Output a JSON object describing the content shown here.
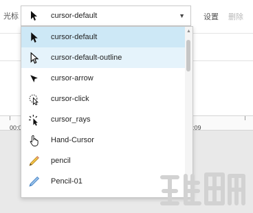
{
  "toolbar": {
    "cursor_label": "光标",
    "selected_value": "cursor-default",
    "settings_label": "设置",
    "delete_label": "删除"
  },
  "timeline": {
    "time_start": "00:0",
    "time_end": ":09"
  },
  "dropdown": {
    "options": [
      {
        "label": "cursor-default",
        "icon": "arrow-cursor-icon",
        "state": "selected"
      },
      {
        "label": "cursor-default-outline",
        "icon": "arrow-outline-cursor-icon",
        "state": "hover"
      },
      {
        "label": "cursor-arrow",
        "icon": "small-arrow-cursor-icon",
        "state": ""
      },
      {
        "label": "cursor-click",
        "icon": "click-cursor-icon",
        "state": ""
      },
      {
        "label": "cursor_rays",
        "icon": "rays-cursor-icon",
        "state": ""
      },
      {
        "label": "Hand-Cursor",
        "icon": "hand-cursor-icon",
        "state": ""
      },
      {
        "label": "pencil",
        "icon": "pencil-icon",
        "state": ""
      },
      {
        "label": "Pencil-01",
        "icon": "blue-pencil-icon",
        "state": ""
      }
    ]
  },
  "colors": {
    "selected_bg": "#cde8f6",
    "hover_bg": "#e5f3fb",
    "pencil_yellow": "#f2c34a",
    "pencil_blue": "#4a86c8"
  }
}
